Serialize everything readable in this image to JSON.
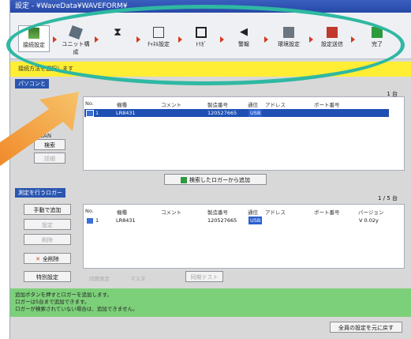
{
  "titlebar": "設定 - ¥WaveData¥WAVEFORM¥",
  "toolbar": {
    "items": [
      {
        "label": "接続設定",
        "icon": "network-icon"
      },
      {
        "label": "ユニット構成",
        "icon": "unit-icon"
      },
      {
        "label": "",
        "icon": "hourglass-icon"
      },
      {
        "label": "ﾁｬﾈﾙ設定",
        "icon": "channel-icon"
      },
      {
        "label": "ﾄﾘｶﾞ",
        "icon": "trigger-icon"
      },
      {
        "label": "警報",
        "icon": "alarm-icon"
      },
      {
        "label": "環境設定",
        "icon": "environment-icon"
      },
      {
        "label": "設定送信",
        "icon": "send-icon"
      },
      {
        "label": "完了",
        "icon": "finish-flag-icon"
      }
    ]
  },
  "notice": "接続方法を選択します",
  "pc_section": {
    "title": "パソコンと",
    "count": "1 台",
    "lan_label": "LAN",
    "search_button": "検索",
    "detail_button": "詳細",
    "columns": [
      "No.",
      "機種",
      "コメント",
      "製造番号",
      "通信",
      "アドレス",
      "ポート番号"
    ],
    "rows": [
      {
        "no": "1",
        "model": "LR8431",
        "comment": "",
        "serial": "120527665",
        "comm": "USB",
        "address": "",
        "port": ""
      }
    ]
  },
  "add_button": "検索したロガーから追加",
  "measure_section": {
    "title": "測定を行うロガー",
    "count": "1 / 5 台",
    "columns": [
      "No.",
      "機種",
      "コメント",
      "製造番号",
      "通信",
      "アドレス",
      "ポート番号",
      "バージョン"
    ],
    "rows": [
      {
        "no": "1",
        "model": "LR8431",
        "comment": "",
        "serial": "120527665",
        "comm": "USB",
        "address": "",
        "port": "",
        "version": "V 0.02y"
      }
    ],
    "manual_add": "手動で追加",
    "edit_button": "設定",
    "delete_button": "削除",
    "delete_all": "全削除",
    "special": "特別設定",
    "sync_label": "同期測定",
    "master_label": "マスタ",
    "sync_test": "同期テスト"
  },
  "help_lines": [
    "追加ボタンを押すとロガーを追加します。",
    "ロガーは5台まで追加できます。",
    "ロガーが検索されていない場合は、追加できません。"
  ],
  "reset_button": "全員の設定を元に戻す"
}
